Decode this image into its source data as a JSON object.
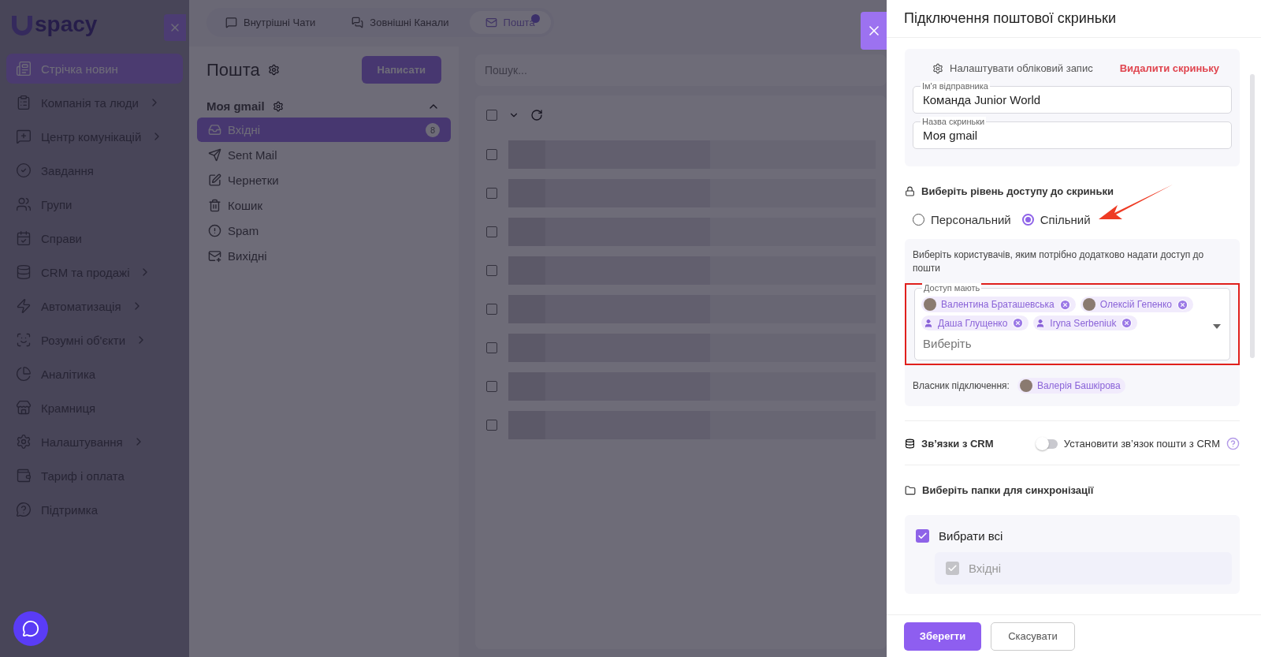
{
  "sidebar": {
    "logo": "spacy",
    "items": [
      {
        "label": "Стрічка новин",
        "selected": true,
        "submenu": false
      },
      {
        "label": "Компанія та люди",
        "selected": false,
        "submenu": true
      },
      {
        "label": "Центр комунікацій",
        "selected": false,
        "submenu": true
      },
      {
        "label": "Завдання",
        "selected": false,
        "submenu": false
      },
      {
        "label": "Групи",
        "selected": false,
        "submenu": false
      },
      {
        "label": "Справи",
        "selected": false,
        "submenu": false
      },
      {
        "label": "CRM та продажі",
        "selected": false,
        "submenu": true
      },
      {
        "label": "Автоматизація",
        "selected": false,
        "submenu": true
      },
      {
        "label": "Розумні об'єкти",
        "selected": false,
        "submenu": true
      },
      {
        "label": "Аналітика",
        "selected": false,
        "submenu": false
      },
      {
        "label": "Крамниця",
        "selected": false,
        "submenu": false
      },
      {
        "label": "Налаштування",
        "selected": false,
        "submenu": true
      },
      {
        "label": "Тариф і оплата",
        "selected": false,
        "submenu": false
      },
      {
        "label": "Підтримка",
        "selected": false,
        "submenu": false
      }
    ]
  },
  "tabs": [
    {
      "label": "Внутрішні Чати",
      "selected": false,
      "badge": false
    },
    {
      "label": "Зовнішні Канали",
      "selected": false,
      "badge": false
    },
    {
      "label": "Пошта",
      "selected": true,
      "badge": true
    }
  ],
  "mail": {
    "title": "Пошта",
    "compose": "Написати",
    "account": "Моя gmail",
    "search_placeholder": "Пошук...",
    "select_all_checked": false,
    "messages": [
      {
        "checked": false
      },
      {
        "checked": false
      },
      {
        "checked": false
      },
      {
        "checked": false
      },
      {
        "checked": false
      },
      {
        "checked": false
      },
      {
        "checked": false
      },
      {
        "checked": false
      }
    ],
    "folders": [
      {
        "label": "Вхідні",
        "selected": true,
        "count": "8"
      },
      {
        "label": "Sent Mail",
        "selected": false
      },
      {
        "label": "Чернетки",
        "selected": false
      },
      {
        "label": "Кошик",
        "selected": false
      },
      {
        "label": "Spam",
        "selected": false
      },
      {
        "label": "Вихідні",
        "selected": false
      }
    ]
  },
  "drawer": {
    "title": "Підключення поштової скриньки",
    "account_settings": "Налаштувати обліковий запис",
    "delete": "Видалити скриньку",
    "fields": [
      {
        "label": "Ім'я відправника",
        "value": "Команда Junior World"
      },
      {
        "label": "Назва скриньки",
        "value": "Моя gmail"
      }
    ],
    "access": {
      "title": "Виберіть рівень доступу до скриньки",
      "options": [
        {
          "label": "Персональний",
          "selected": false
        },
        {
          "label": "Спільний",
          "selected": true
        }
      ]
    },
    "users": {
      "hint": "Виберіть користувачів, яким потрібно додатково надати доступ до пошти",
      "label": "Доступ мають",
      "placeholder": "Виберіть",
      "highlighted": true,
      "chips": [
        {
          "name": "Валентина Браташевська",
          "kind": "photo"
        },
        {
          "name": "Олексій Гепенко",
          "kind": "photo"
        },
        {
          "name": "Даша Глущенко",
          "kind": "generic"
        },
        {
          "name": "Iryna Serbeniuk",
          "kind": "generic"
        }
      ]
    },
    "owner": {
      "label": "Власник підключення:",
      "name": "Валерія Башкірова"
    },
    "crm": {
      "title": "Зв’язки з CRM",
      "toggle_label": "Установити зв’язок пошти з CRM",
      "on": false
    },
    "folders": {
      "title": "Виберіть папки для синхронізації",
      "select_all": {
        "label": "Вибрати всі",
        "checked": true
      },
      "items": [
        {
          "label": "Вхідні",
          "checked": true,
          "disabled": true
        }
      ]
    },
    "save": "Зберегти",
    "cancel": "Скасувати"
  }
}
